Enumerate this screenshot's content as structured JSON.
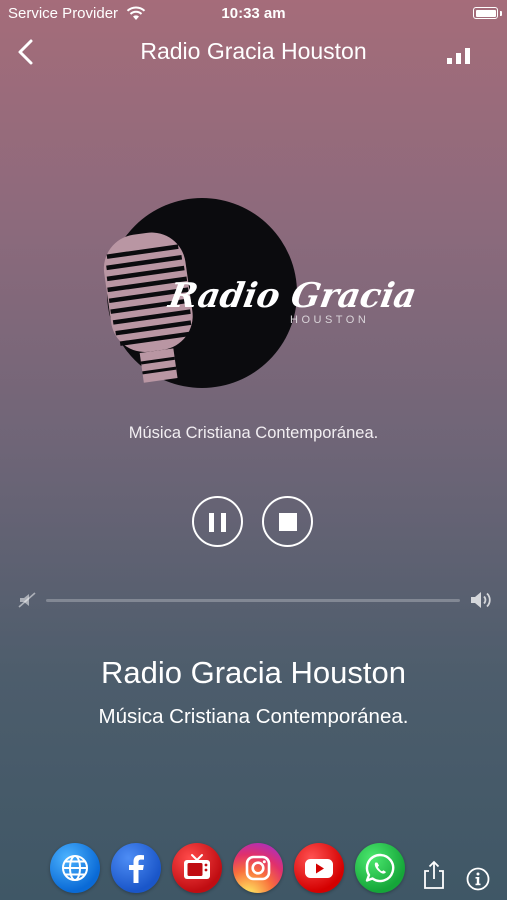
{
  "status_bar": {
    "carrier": "Service Provider",
    "time": "10:33 am"
  },
  "nav": {
    "title": "Radio Gracia Houston"
  },
  "logo": {
    "name_script": "Radio Gracia",
    "city": "HOUSTON"
  },
  "station": {
    "subtitle": "Música Cristiana Contemporánea."
  },
  "player": {
    "state": "playing",
    "volume": 0
  },
  "now_playing": {
    "title": "Radio Gracia Houston",
    "subtitle": "Música Cristiana Contemporánea."
  },
  "social_icons": [
    "globe-icon",
    "facebook-icon",
    "tv-icon",
    "instagram-icon",
    "youtube-icon",
    "whatsapp-icon"
  ],
  "colors": {
    "background_top": "#a56c7a",
    "background_bottom": "#3f5766"
  }
}
